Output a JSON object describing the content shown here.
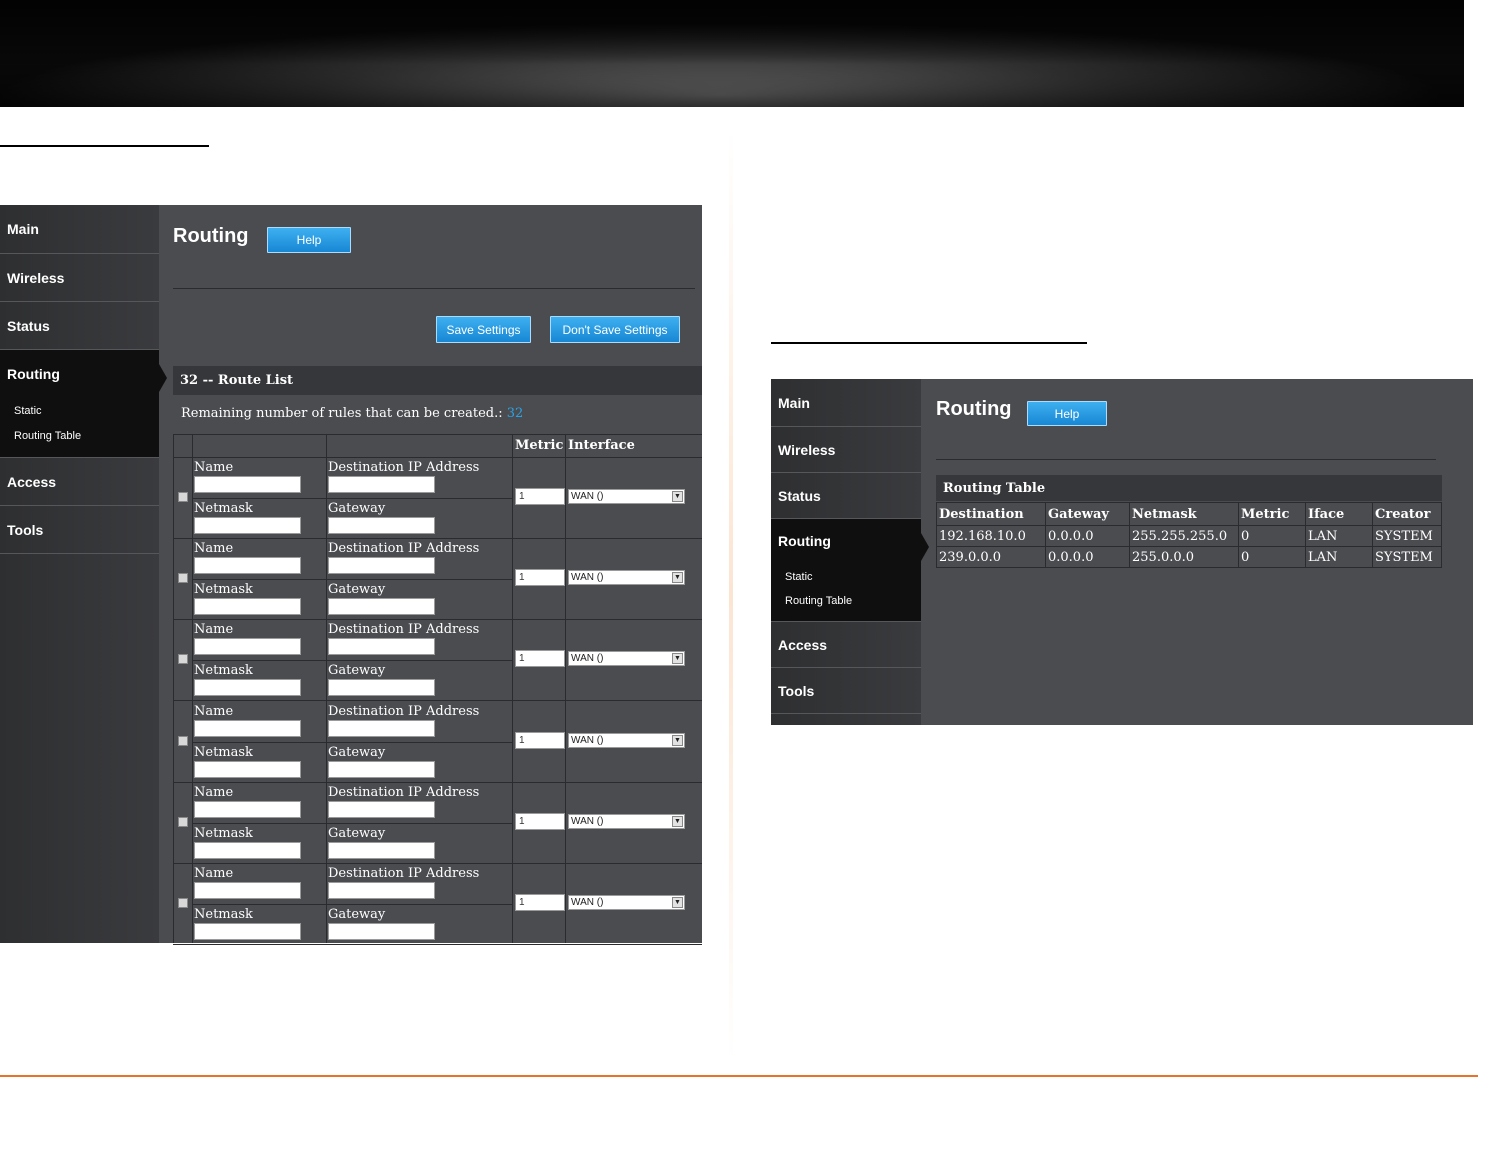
{
  "left_panel": {
    "nav": [
      {
        "label": "Main"
      },
      {
        "label": "Wireless"
      },
      {
        "label": "Status"
      },
      {
        "label": "Routing"
      },
      {
        "label": "Access"
      },
      {
        "label": "Tools"
      }
    ],
    "sub_nav": [
      {
        "label": "Static"
      },
      {
        "label": "Routing Table"
      }
    ],
    "title": "Routing",
    "help_label": "Help",
    "save_label": "Save Settings",
    "dont_save_label": "Don't Save Settings",
    "route_list_title": "32 -- Route List",
    "remaining_label": "Remaining number of rules that can be created.:",
    "remaining_value": "32",
    "columns": {
      "metric": "Metric",
      "interface": "Interface"
    },
    "field_labels": {
      "name": "Name",
      "destination": "Destination IP Address",
      "netmask": "Netmask",
      "gateway": "Gateway"
    },
    "rows": [
      {
        "metric": "1",
        "interface": "WAN ()"
      },
      {
        "metric": "1",
        "interface": "WAN ()"
      },
      {
        "metric": "1",
        "interface": "WAN ()"
      },
      {
        "metric": "1",
        "interface": "WAN ()"
      },
      {
        "metric": "1",
        "interface": "WAN ()"
      },
      {
        "metric": "1",
        "interface": "WAN ()"
      }
    ]
  },
  "right_panel": {
    "nav": [
      {
        "label": "Main"
      },
      {
        "label": "Wireless"
      },
      {
        "label": "Status"
      },
      {
        "label": "Routing"
      },
      {
        "label": "Access"
      },
      {
        "label": "Tools"
      }
    ],
    "sub_nav": [
      {
        "label": "Static"
      },
      {
        "label": "Routing Table"
      }
    ],
    "title": "Routing",
    "help_label": "Help",
    "table_title": "Routing Table",
    "table_headers": [
      "Destination",
      "Gateway",
      "Netmask",
      "Metric",
      "Iface",
      "Creator"
    ],
    "table_rows": [
      [
        "192.168.10.0",
        "0.0.0.0",
        "255.255.255.0",
        "0",
        "LAN",
        "SYSTEM"
      ],
      [
        "239.0.0.0",
        "0.0.0.0",
        "255.0.0.0",
        "0",
        "LAN",
        "SYSTEM"
      ]
    ]
  },
  "colors": {
    "accent": "#29a3e6",
    "footer_rule": "#e8722c",
    "panel_bg": "#4b4c50"
  }
}
